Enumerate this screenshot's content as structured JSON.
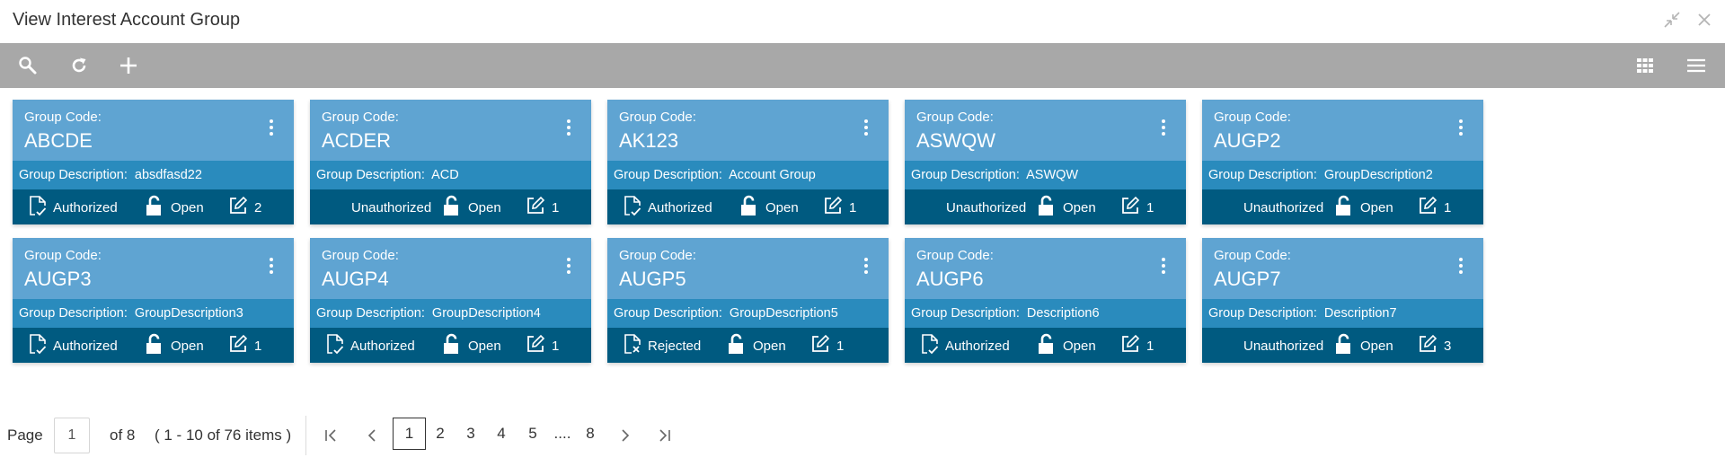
{
  "window": {
    "title": "View Interest Account Group",
    "minimize_icon": "minimize-icon",
    "close_icon": "close-icon"
  },
  "toolbar": {
    "search_icon": "search-icon",
    "refresh_icon": "refresh-icon",
    "add_icon": "add-icon",
    "grid_view_icon": "grid-view-icon",
    "list_view_icon": "list-view-icon"
  },
  "colors": {
    "toolbar_bg": "#a8a8a8",
    "card_header": "#5fa4d2",
    "card_description": "#2a8bbd",
    "card_footer": "#005a80"
  },
  "cards": [
    {
      "code_label": "Group Code:",
      "code": "ABCDE",
      "desc_label": "Group Description:",
      "description": "absdfasd22",
      "status": "Authorized",
      "lock": "Open",
      "edits": "2"
    },
    {
      "code_label": "Group Code:",
      "code": "ACDER",
      "desc_label": "Group Description:",
      "description": "ACD",
      "status": "Unauthorized",
      "lock": "Open",
      "edits": "1"
    },
    {
      "code_label": "Group Code:",
      "code": "AK123",
      "desc_label": "Group Description:",
      "description": "Account Group",
      "status": "Authorized",
      "lock": "Open",
      "edits": "1"
    },
    {
      "code_label": "Group Code:",
      "code": "ASWQW",
      "desc_label": "Group Description:",
      "description": "ASWQW",
      "status": "Unauthorized",
      "lock": "Open",
      "edits": "1"
    },
    {
      "code_label": "Group Code:",
      "code": "AUGP2",
      "desc_label": "Group Description:",
      "description": "GroupDescription2",
      "status": "Unauthorized",
      "lock": "Open",
      "edits": "1"
    },
    {
      "code_label": "Group Code:",
      "code": "AUGP3",
      "desc_label": "Group Description:",
      "description": "GroupDescription3",
      "status": "Authorized",
      "lock": "Open",
      "edits": "1"
    },
    {
      "code_label": "Group Code:",
      "code": "AUGP4",
      "desc_label": "Group Description:",
      "description": "GroupDescription4",
      "status": "Authorized",
      "lock": "Open",
      "edits": "1"
    },
    {
      "code_label": "Group Code:",
      "code": "AUGP5",
      "desc_label": "Group Description:",
      "description": "GroupDescription5",
      "status": "Rejected",
      "lock": "Open",
      "edits": "1"
    },
    {
      "code_label": "Group Code:",
      "code": "AUGP6",
      "desc_label": "Group Description:",
      "description": "Description6",
      "status": "Authorized",
      "lock": "Open",
      "edits": "1"
    },
    {
      "code_label": "Group Code:",
      "code": "AUGP7",
      "desc_label": "Group Description:",
      "description": "Description7",
      "status": "Unauthorized",
      "lock": "Open",
      "edits": "3"
    }
  ],
  "pagination": {
    "page_label": "Page",
    "page_value": "1",
    "of_total": "of 8",
    "items_summary": "( 1 - 10 of 76 items )",
    "pages": [
      "1",
      "2",
      "3",
      "4",
      "5",
      "....",
      "8"
    ],
    "current_page": "1"
  }
}
